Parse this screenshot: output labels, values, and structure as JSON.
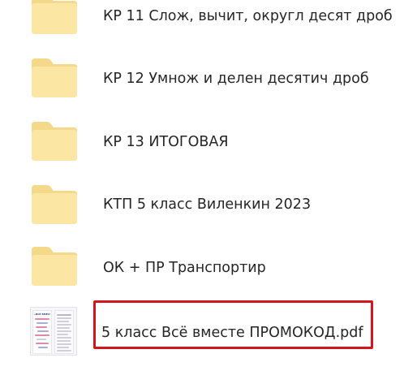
{
  "colors": {
    "folder_body": "#fbe6a3",
    "folder_tab": "#f5d98a",
    "text": "#262626",
    "highlight_border": "#d4151b"
  },
  "files": [
    {
      "name": "КР 11 Слож, вычит, округл десят дроб",
      "icon": "folder-icon"
    },
    {
      "name": "КР 12 Умнож и делен десятич дроб",
      "icon": "folder-icon"
    },
    {
      "name": "КР 13 ИТОГОВАЯ",
      "icon": "folder-icon"
    },
    {
      "name": "КТП 5 класс Виленкин 2023",
      "icon": "folder-icon"
    },
    {
      "name": "ОК + ПР Транспортир",
      "icon": "folder-icon"
    },
    {
      "name": "5 класс Всё вместе ПРОМОКОД.pdf",
      "icon": "pdf-thumbnail",
      "highlighted": true
    }
  ],
  "pdf_thumbnail": {
    "cover_title": "«ВСЁ ВМЕСТЕ»"
  }
}
